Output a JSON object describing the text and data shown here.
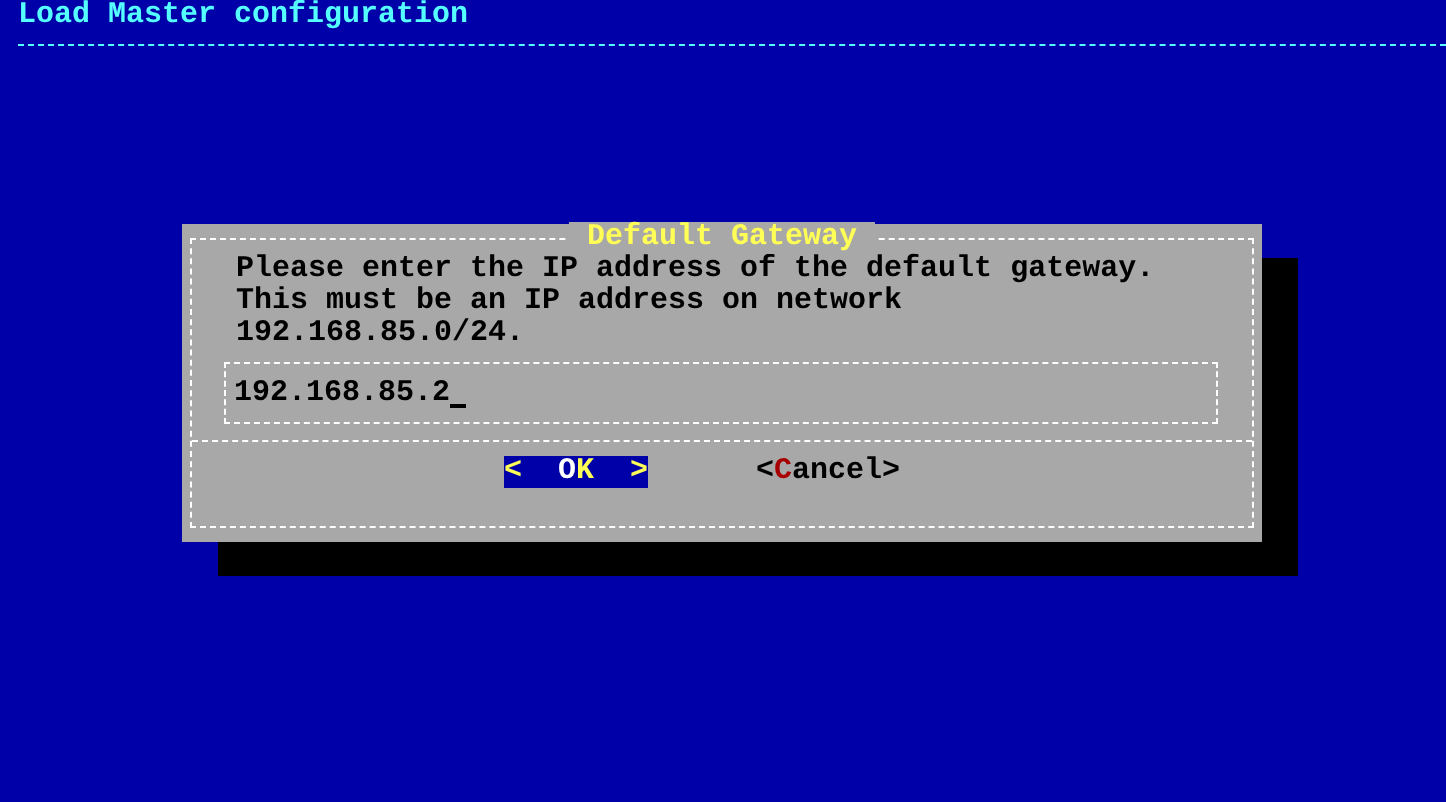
{
  "header": {
    "title": "Load Master configuration"
  },
  "dialog": {
    "title": "Default Gateway",
    "message": "Please enter the IP address of the default gateway.\nThis must be an IP address on network\n192.168.85.0/24.",
    "input": {
      "value": "192.168.85.2"
    },
    "buttons": [
      {
        "prefix": "<  ",
        "hotkey": "O",
        "rest": "K  >",
        "selected": true
      },
      {
        "prefix": "<",
        "hotkey": "C",
        "rest": "ancel>",
        "selected": false
      }
    ]
  }
}
